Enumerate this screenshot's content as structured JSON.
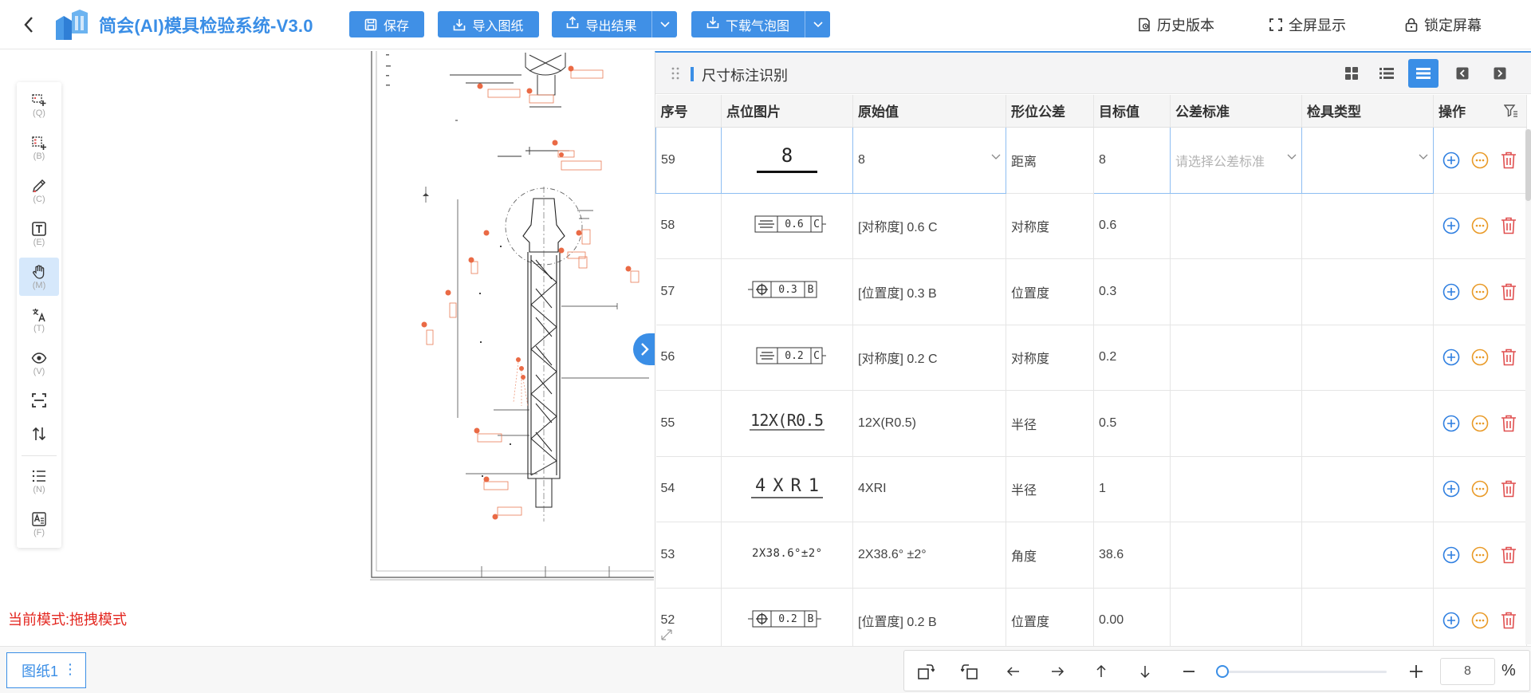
{
  "header": {
    "title": "简会(AI)模具检验系统-V3.0",
    "buttons": {
      "save": "保存",
      "import": "导入图纸",
      "export": "导出结果",
      "download": "下载气泡图"
    },
    "links": {
      "history": "历史版本",
      "fullscreen": "全屏显示",
      "lock": "锁定屏幕"
    }
  },
  "toolbar": {
    "tools": [
      {
        "icon": "add-box-icon",
        "key": "(Q)"
      },
      {
        "icon": "add-list-icon",
        "key": "(B)"
      },
      {
        "icon": "pencil-icon",
        "key": "(C)"
      },
      {
        "icon": "text-box-icon",
        "key": "(E)"
      },
      {
        "icon": "hand-icon",
        "key": "(M)"
      },
      {
        "icon": "translate-icon",
        "key": "(T)"
      },
      {
        "icon": "eye-icon",
        "key": "(V)"
      },
      {
        "icon": "scan-icon",
        "key": ""
      },
      {
        "icon": "swap-vertical-icon",
        "key": ""
      },
      {
        "icon": "list-icon",
        "key": "(N)"
      },
      {
        "icon": "text-format-icon",
        "key": "(F)"
      }
    ]
  },
  "mode_text": "当前模式:拖拽模式",
  "panel": {
    "title": "尺寸标注识别",
    "columns": [
      "序号",
      "点位图片",
      "原始值",
      "形位公差",
      "目标值",
      "公差标准",
      "检具类型",
      "操作"
    ],
    "standard_placeholder": "请选择公差标准",
    "rows": [
      {
        "no": "59",
        "image": "8",
        "raw": "8",
        "geo": "距离",
        "target": "8"
      },
      {
        "no": "58",
        "image": "0.6 C",
        "raw": "[对称度] 0.6 C",
        "geo": "对称度",
        "target": "0.6"
      },
      {
        "no": "57",
        "image": "0.3 B",
        "raw": "[位置度] 0.3 B",
        "geo": "位置度",
        "target": "0.3"
      },
      {
        "no": "56",
        "image": "0.2 C",
        "raw": "[对称度] 0.2 C",
        "geo": "对称度",
        "target": "0.2"
      },
      {
        "no": "55",
        "image": "12X(R0.5",
        "raw": "12X(R0.5)",
        "geo": "半径",
        "target": "0.5"
      },
      {
        "no": "54",
        "image": "4XR1",
        "raw": "4XRI",
        "geo": "半径",
        "target": "1"
      },
      {
        "no": "53",
        "image": "2X38.6°±2°",
        "raw": "2X38.6° ±2°",
        "geo": "角度",
        "target": "38.6"
      },
      {
        "no": "52",
        "image": "0.2 B",
        "raw": "[位置度] 0.2 B",
        "geo": "位置度",
        "target": "0.00"
      }
    ]
  },
  "bottom": {
    "sheet_tab": "图纸1",
    "zoom_value": "8",
    "zoom_unit": "%",
    "zoom_level": 0.0
  },
  "colors": {
    "accent": "#3a8ee6",
    "add": "#2f7fe0",
    "more": "#e99a27",
    "delete": "#e05050",
    "mode_text": "#e3261f"
  }
}
